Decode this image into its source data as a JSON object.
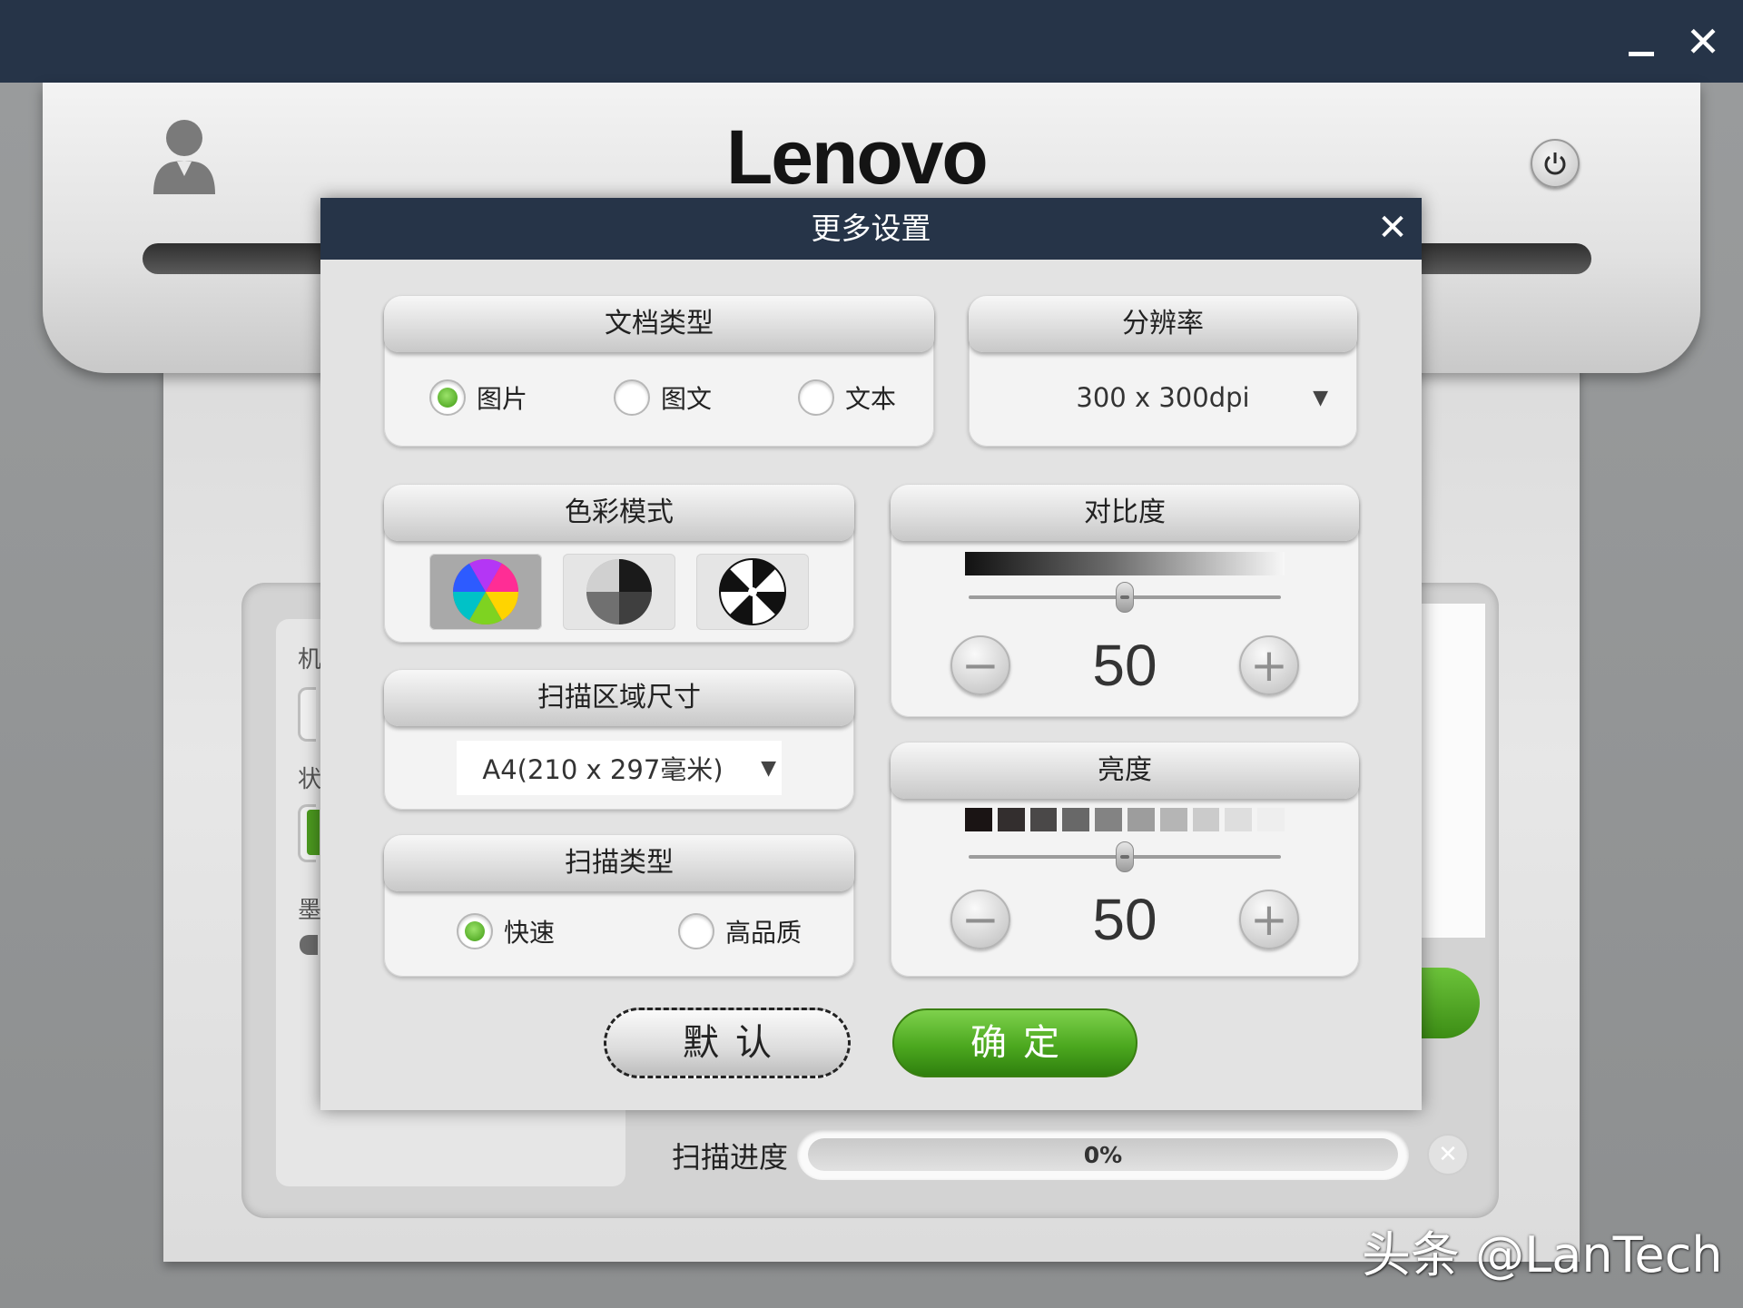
{
  "window": {
    "minimize_icon": "minimize-icon",
    "close_icon": "close-icon"
  },
  "scanner": {
    "brand": "Lenovo",
    "left_labels": [
      "机",
      "状",
      "墨"
    ]
  },
  "dialog": {
    "title": "更多设置",
    "doc_type": {
      "title": "文档类型",
      "options": [
        "图片",
        "图文",
        "文本"
      ],
      "selected": "图片"
    },
    "resolution": {
      "title": "分辨率",
      "value": "300 x 300dpi"
    },
    "color_mode": {
      "title": "色彩模式",
      "options": [
        "color-wheel-icon",
        "grayscale-wheel-icon",
        "black-white-wheel-icon"
      ],
      "selected": "color-wheel-icon"
    },
    "scan_area": {
      "title": "扫描区域尺寸",
      "value": "A4(210 x 297毫米)"
    },
    "scan_type": {
      "title": "扫描类型",
      "options": [
        "快速",
        "高品质"
      ],
      "selected": "快速"
    },
    "contrast": {
      "title": "对比度",
      "value": "50",
      "level": 0.5
    },
    "brightness": {
      "title": "亮度",
      "value": "50",
      "level": 0.5
    },
    "buttons": {
      "default": "默认",
      "ok": "确定"
    }
  },
  "progress": {
    "label": "扫描进度",
    "value_text": "0%",
    "fraction": 0
  },
  "watermark": "头条 @LanTech",
  "colors": {
    "titlebar": "#263448",
    "accent_green": "#4ca81f"
  }
}
